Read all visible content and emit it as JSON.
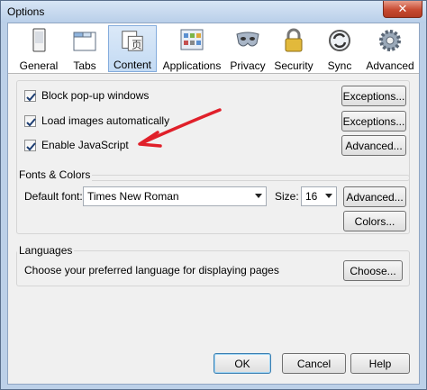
{
  "window": {
    "title": "Options",
    "close_glyph": "✕"
  },
  "toolbar": {
    "items": [
      {
        "label": "General",
        "icon": "general-icon"
      },
      {
        "label": "Tabs",
        "icon": "tabs-icon"
      },
      {
        "label": "Content",
        "icon": "content-icon",
        "selected": true
      },
      {
        "label": "Applications",
        "icon": "applications-icon"
      },
      {
        "label": "Privacy",
        "icon": "privacy-mask-icon"
      },
      {
        "label": "Security",
        "icon": "padlock-icon"
      },
      {
        "label": "Sync",
        "icon": "sync-icon"
      },
      {
        "label": "Advanced",
        "icon": "gear-icon"
      }
    ]
  },
  "content": {
    "options": [
      {
        "label": "Block pop-up windows",
        "checked": true,
        "button": "Exceptions..."
      },
      {
        "label": "Load images automatically",
        "checked": true,
        "button": "Exceptions..."
      },
      {
        "label": "Enable JavaScript",
        "checked": true,
        "button": "Advanced..."
      }
    ],
    "annotation": {
      "type": "red-arrow",
      "color": "#e0202a",
      "points_to": "Enable JavaScript"
    }
  },
  "fonts": {
    "group_label": "Fonts & Colors",
    "default_font_label": "Default font:",
    "default_font_value": "Times New Roman",
    "size_label": "Size:",
    "size_value": "16",
    "advanced_button": "Advanced...",
    "colors_button": "Colors..."
  },
  "languages": {
    "group_label": "Languages",
    "description": "Choose your preferred language for displaying pages",
    "choose_button": "Choose..."
  },
  "footer": {
    "ok": "OK",
    "cancel": "Cancel",
    "help": "Help"
  },
  "colors": {
    "accent": "#84acdd",
    "annotation": "#e0202a"
  }
}
